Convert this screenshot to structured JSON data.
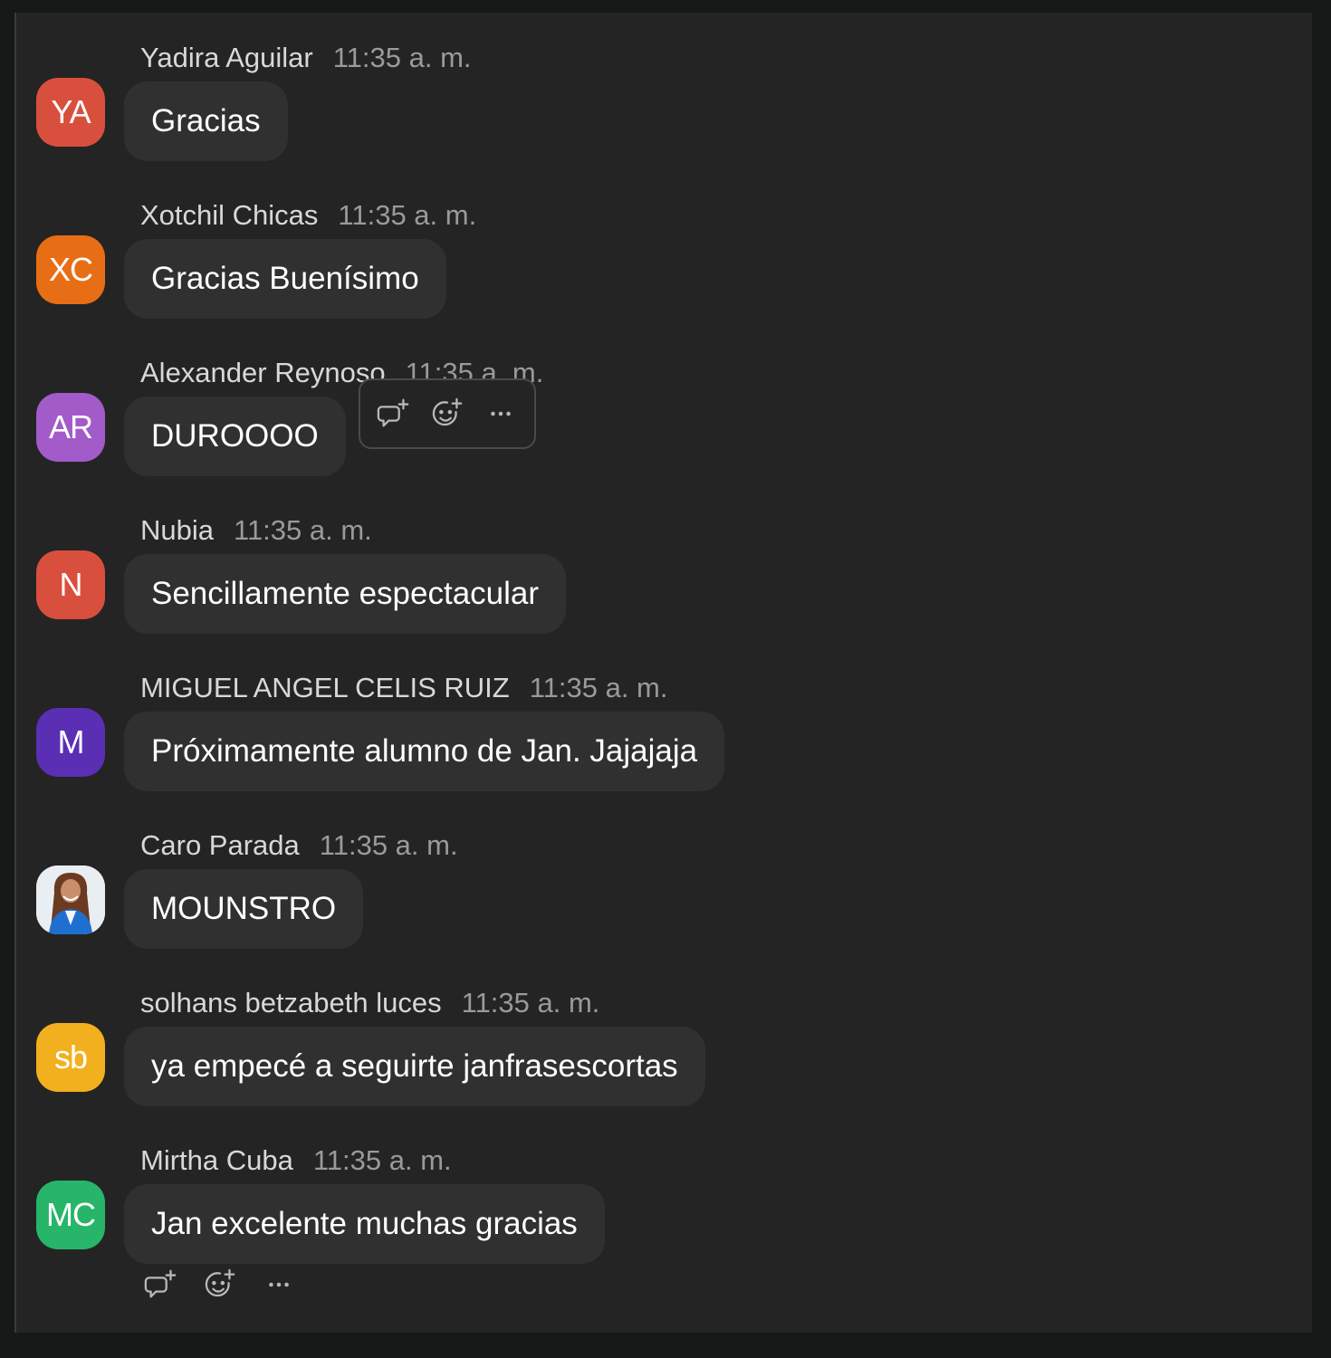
{
  "colors": {
    "background": "#242424",
    "bubble": "#303030",
    "name_text": "#d8d8d8",
    "time_text": "#9a9a9a",
    "message_text": "#ffffff"
  },
  "messages": [
    {
      "initials": "YA",
      "avatar_color": "#d94f3d",
      "name": "Yadira Aguilar",
      "time": "11:35 a. m.",
      "text": "Gracias"
    },
    {
      "initials": "XC",
      "avatar_color": "#e86e15",
      "name": "Xotchil Chicas",
      "time": "11:35 a. m.",
      "text": "Gracias Buenísimo"
    },
    {
      "initials": "AR",
      "avatar_color": "#a25bc9",
      "name": "Alexander Reynoso",
      "time": "11:35 a. m.",
      "text": "DUROOOO"
    },
    {
      "initials": "N",
      "avatar_color": "#d94f3d",
      "name": "Nubia",
      "time": "11:35 a. m.",
      "text": "Sencillamente espectacular"
    },
    {
      "initials": "M",
      "avatar_color": "#5a2fb4",
      "name": "MIGUEL ANGEL CELIS RUIZ",
      "time": "11:35 a. m.",
      "text": "Próximamente alumno de Jan. Jajajaja"
    },
    {
      "initials": "",
      "avatar_color": "#e8edf2",
      "name": "Caro Parada",
      "time": "11:35 a. m.",
      "text": "MOUNSTRO"
    },
    {
      "initials": "sb",
      "avatar_color": "#f2b01e",
      "name": "solhans betzabeth luces",
      "time": "11:35 a. m.",
      "text": "ya empecé a seguirte janfrasescortas"
    },
    {
      "initials": "MC",
      "avatar_color": "#27b56a",
      "name": "Mirtha Cuba",
      "time": "11:35 a. m.",
      "text": "Jan excelente muchas gracias"
    }
  ],
  "actions": {
    "reply_icon": "reply-plus-icon",
    "react_icon": "emoji-plus-icon",
    "more_icon": "more-horizontal-icon"
  }
}
